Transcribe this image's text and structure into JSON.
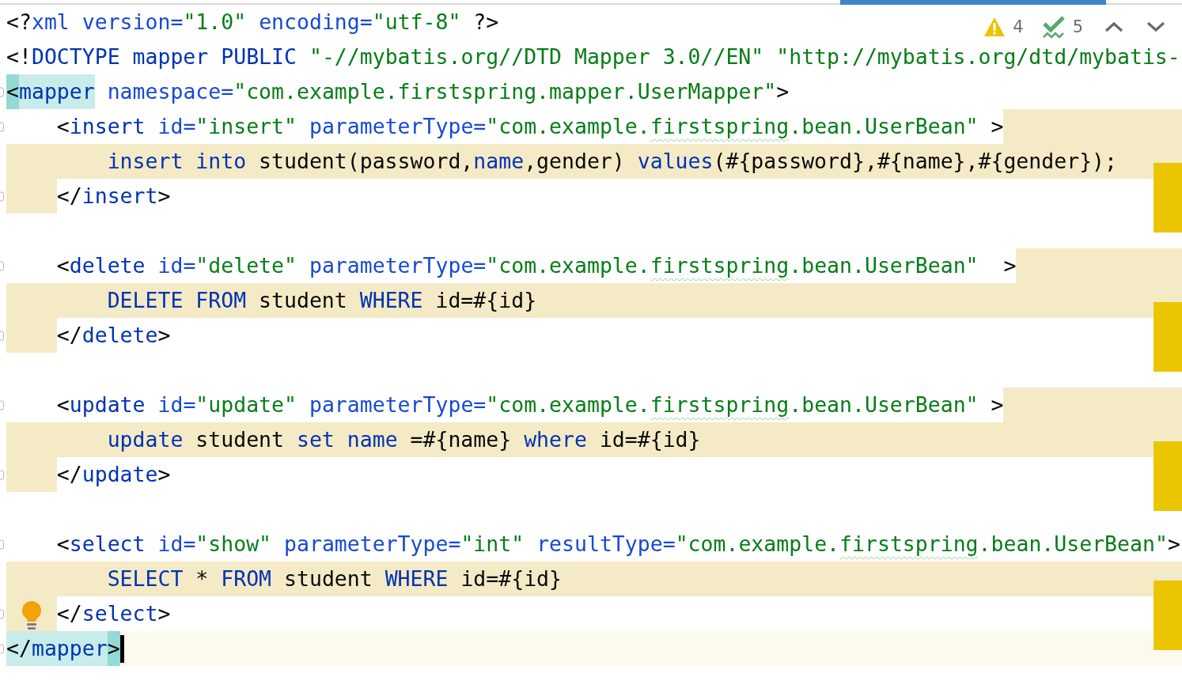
{
  "editor": {
    "lines": [
      {
        "kind": "code",
        "current": false,
        "bulb": false,
        "tokens": [
          {
            "text": "<?",
            "kind": "punct"
          },
          {
            "text": "xml",
            "kind": "attr"
          },
          {
            "text": " version=",
            "kind": "attr"
          },
          {
            "text": "\"1.0\"",
            "kind": "value"
          },
          {
            "text": " encoding=",
            "kind": "attr"
          },
          {
            "text": "\"utf-8\"",
            "kind": "value"
          },
          {
            "text": " ?>",
            "kind": "punct"
          }
        ]
      },
      {
        "kind": "code",
        "current": false,
        "bulb": false,
        "tokens": [
          {
            "text": "<!",
            "kind": "punct"
          },
          {
            "text": "DOCTYPE mapper PUBLIC",
            "kind": "tag"
          },
          {
            "text": " \"-//mybatis.org//DTD Mapper 3.0//EN\" \"http://mybatis.org/dtd/mybatis-",
            "kind": "value"
          }
        ]
      },
      {
        "kind": "code",
        "current": false,
        "bulb": false,
        "tokens": [
          {
            "text": "<",
            "kind": "bracket_match"
          },
          {
            "text": "mapper",
            "kind": "tag_match"
          },
          {
            "text": " namespace=",
            "kind": "attr"
          },
          {
            "text": "\"com.example.firstspring.mapper.UserMapper\"",
            "kind": "value"
          },
          {
            "text": ">",
            "kind": "punct"
          }
        ],
        "children": [
          {
            "kind": "code",
            "current": false,
            "bulb": false,
            "tokens": [
              {
                "text": "<",
                "kind": "punct"
              },
              {
                "text": "insert",
                "kind": "tag"
              },
              {
                "text": " id=",
                "kind": "attr"
              },
              {
                "text": "\"insert\"",
                "kind": "value"
              },
              {
                "text": " parameterType=",
                "kind": "attr"
              },
              {
                "text": "\"com.example.",
                "kind": "value"
              },
              {
                "text": "firstspring",
                "kind": "typo"
              },
              {
                "text": ".bean.UserBean\"",
                "kind": "value"
              },
              {
                "text": " >",
                "kind": "punct"
              }
            ],
            "children": [
              {
                "kind": "sql",
                "current": false,
                "bulb": false,
                "tokens": [
                  {
                    "text": "insert into",
                    "kind": "keyword"
                  },
                  {
                    "text": " student(password,",
                    "kind": "plain"
                  },
                  {
                    "text": "name",
                    "kind": "keyword"
                  },
                  {
                    "text": ",gender) ",
                    "kind": "plain"
                  },
                  {
                    "text": "values",
                    "kind": "keyword"
                  },
                  {
                    "text": "(#{password},#{name},#{gender});",
                    "kind": "plain"
                  }
                ]
              }
            ]
          },
          {
            "kind": "code",
            "current": false,
            "bulb": false,
            "tokens": [
              {
                "text": "</",
                "kind": "punct"
              },
              {
                "text": "insert",
                "kind": "tag"
              },
              {
                "text": ">",
                "kind": "punct"
              }
            ]
          },
          {
            "kind": "blank",
            "current": false,
            "bulb": false
          },
          {
            "kind": "code",
            "current": false,
            "bulb": false,
            "tokens": [
              {
                "text": "<",
                "kind": "punct"
              },
              {
                "text": "delete",
                "kind": "tag"
              },
              {
                "text": " id=",
                "kind": "attr"
              },
              {
                "text": "\"delete\"",
                "kind": "value"
              },
              {
                "text": " parameterType=",
                "kind": "attr"
              },
              {
                "text": "\"com.example.",
                "kind": "value"
              },
              {
                "text": "firstspring",
                "kind": "typo"
              },
              {
                "text": ".bean.UserBean\"",
                "kind": "value"
              },
              {
                "text": "  >",
                "kind": "punct"
              }
            ],
            "children": [
              {
                "kind": "sql",
                "current": false,
                "bulb": false,
                "tokens": [
                  {
                    "text": "DELETE FROM",
                    "kind": "keyword"
                  },
                  {
                    "text": " student ",
                    "kind": "plain"
                  },
                  {
                    "text": "WHERE",
                    "kind": "keyword"
                  },
                  {
                    "text": " id=#{id}",
                    "kind": "plain"
                  }
                ]
              }
            ]
          },
          {
            "kind": "code",
            "current": false,
            "bulb": false,
            "tokens": [
              {
                "text": "</",
                "kind": "punct"
              },
              {
                "text": "delete",
                "kind": "tag"
              },
              {
                "text": ">",
                "kind": "punct"
              }
            ]
          },
          {
            "kind": "blank",
            "current": false,
            "bulb": false
          },
          {
            "kind": "code",
            "current": false,
            "bulb": false,
            "tokens": [
              {
                "text": "<",
                "kind": "punct"
              },
              {
                "text": "update",
                "kind": "tag"
              },
              {
                "text": " id=",
                "kind": "attr"
              },
              {
                "text": "\"update\"",
                "kind": "value"
              },
              {
                "text": " parameterType=",
                "kind": "attr"
              },
              {
                "text": "\"com.example.",
                "kind": "value"
              },
              {
                "text": "firstspring",
                "kind": "typo"
              },
              {
                "text": ".bean.UserBean\"",
                "kind": "value"
              },
              {
                "text": " >",
                "kind": "punct"
              }
            ],
            "children": [
              {
                "kind": "sql",
                "current": false,
                "bulb": false,
                "tokens": [
                  {
                    "text": "update",
                    "kind": "keyword"
                  },
                  {
                    "text": " student ",
                    "kind": "plain"
                  },
                  {
                    "text": "set name",
                    "kind": "keyword"
                  },
                  {
                    "text": " =#{name} ",
                    "kind": "plain"
                  },
                  {
                    "text": "where",
                    "kind": "keyword"
                  },
                  {
                    "text": " id=#{id}",
                    "kind": "plain"
                  }
                ]
              }
            ]
          },
          {
            "kind": "code",
            "current": false,
            "bulb": false,
            "tokens": [
              {
                "text": "</",
                "kind": "punct"
              },
              {
                "text": "update",
                "kind": "tag"
              },
              {
                "text": ">",
                "kind": "punct"
              }
            ]
          },
          {
            "kind": "blank",
            "current": false,
            "bulb": false
          },
          {
            "kind": "code",
            "current": false,
            "bulb": false,
            "tokens": [
              {
                "text": "<",
                "kind": "punct"
              },
              {
                "text": "select",
                "kind": "tag"
              },
              {
                "text": " id=",
                "kind": "attr"
              },
              {
                "text": "\"show\"",
                "kind": "value"
              },
              {
                "text": " parameterType=",
                "kind": "attr"
              },
              {
                "text": "\"int\"",
                "kind": "value"
              },
              {
                "text": " resultType=",
                "kind": "attr"
              },
              {
                "text": "\"com.example.",
                "kind": "value"
              },
              {
                "text": "firstspring",
                "kind": "typo"
              },
              {
                "text": ".bean.UserBean\"",
                "kind": "value"
              },
              {
                "text": ">",
                "kind": "punct"
              }
            ],
            "children": [
              {
                "kind": "sql",
                "current": false,
                "bulb": false,
                "tokens": [
                  {
                    "text": "SELECT",
                    "kind": "keyword"
                  },
                  {
                    "text": " * ",
                    "kind": "plain"
                  },
                  {
                    "text": "FROM",
                    "kind": "keyword"
                  },
                  {
                    "text": " student ",
                    "kind": "plain"
                  },
                  {
                    "text": "WHERE",
                    "kind": "keyword"
                  },
                  {
                    "text": " id=#{id}",
                    "kind": "plain"
                  }
                ]
              }
            ]
          },
          {
            "kind": "code",
            "current": false,
            "bulb": true,
            "tokens": [
              {
                "text": "</",
                "kind": "punct"
              },
              {
                "text": "select",
                "kind": "tag"
              },
              {
                "text": ">",
                "kind": "punct"
              }
            ]
          }
        ]
      },
      {
        "kind": "code",
        "current": true,
        "bulb": false,
        "tokens": [
          {
            "text": "</",
            "kind": "punct_match"
          },
          {
            "text": "mapper",
            "kind": "tag_match"
          },
          {
            "text": ">",
            "kind": "bracket_match"
          }
        ]
      }
    ]
  },
  "inspection_widget": {
    "counters": [
      {
        "kind": "warning",
        "count": "4"
      },
      {
        "kind": "typo",
        "count": "5"
      }
    ]
  }
}
